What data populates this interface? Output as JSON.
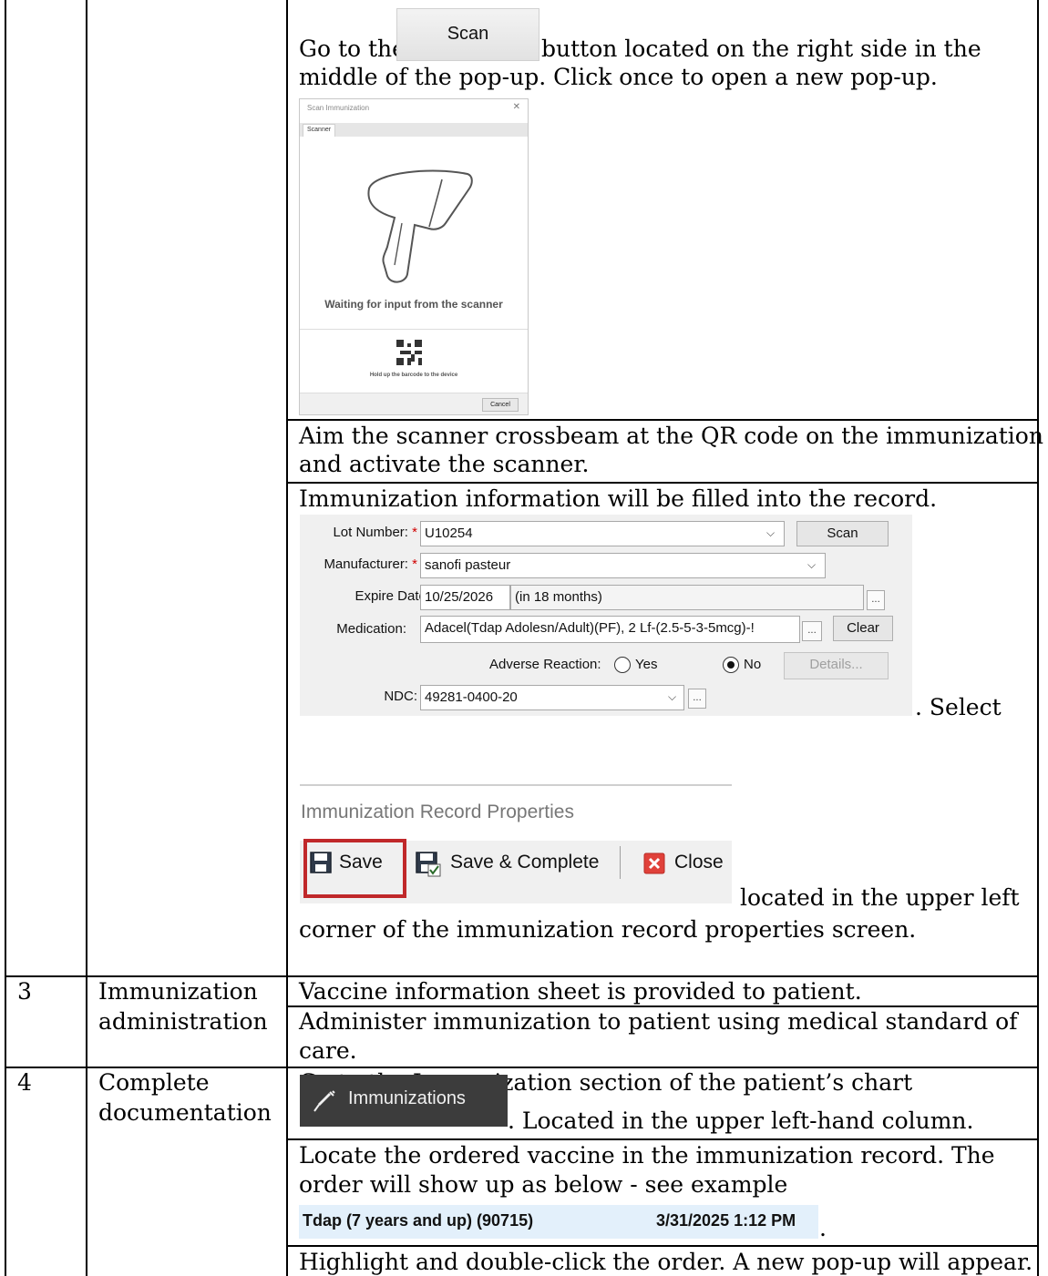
{
  "step2": {
    "scan_text_before": "Go to the",
    "scan_button_label": "Scan",
    "scan_text_after": "button located on the right side in the",
    "scan_text_line2": "middle of the pop-up. Click once to open a new pop-up.",
    "scan_dialog": {
      "title": "Scan Immunization",
      "tab": "Scanner",
      "waiting": "Waiting for input from the scanner",
      "hold": "Hold up the barcode to the device",
      "cancel": "Cancel"
    },
    "aim_line1": "Aim the scanner crossbeam at the QR code on the immunization",
    "aim_line2": "and activate the scanner.",
    "filled_text": "Immunization information will be filled into the record.",
    "form": {
      "lot_label": "Lot Number:",
      "lot_value": "U10254",
      "scan_label": "Scan",
      "manufacturer_label": "Manufacturer:",
      "manufacturer_value": "sanofi pasteur",
      "expire_label": "Expire Date:",
      "expire_value": "10/25/2026",
      "expire_relative": "(in 18 months)",
      "medication_label": "Medication:",
      "medication_value": "Adacel(Tdap Adolesn/Adult)(PF), 2 Lf-(2.5-5-3-5mcg)-!",
      "clear_label": "Clear",
      "adverse_label": "Adverse Reaction:",
      "yes_label": "Yes",
      "no_label": "No",
      "details_label": "Details...",
      "ndc_label": "NDC:",
      "ndc_value": "49281-0400-20",
      "ellipsis": "..."
    },
    "select_text": ". Select",
    "record_props": {
      "title": "Immunization Record Properties",
      "save": "Save",
      "save_complete": "Save & Complete",
      "close": "Close"
    },
    "located_line1": "located in the upper left",
    "located_line2": "corner of the immunization record properties screen."
  },
  "step3": {
    "number": "3",
    "title_line1": "Immunization",
    "title_line2": "administration",
    "vis_text": "Vaccine information sheet is provided to patient.",
    "admin_line1": "Administer immunization to patient using medical standard of",
    "admin_line2": "care."
  },
  "step4": {
    "number": "4",
    "title_line1": "Complete",
    "title_line2": "documentation",
    "goto_text": "Go to the Immunization section of the patient’s chart",
    "immunizations_button": "Immunizations",
    "located_text": ". Located in the upper left-hand column.",
    "locate_line1": "Locate the ordered vaccine in the immunization record. The",
    "locate_line2": "order will show up as below - see example",
    "order_name": "Tdap (7 years and up) (90715)",
    "order_time": "3/31/2025 1:12 PM",
    "order_period": ".",
    "highlight_text": "Highlight and double-click the order. A new pop-up will appear."
  },
  "colors": {
    "save_highlight": "#c0282a",
    "order_highlight": "#e3f0fb",
    "immunizations_button_bg": "#3c3c3c",
    "required_marker": "#d00000"
  }
}
